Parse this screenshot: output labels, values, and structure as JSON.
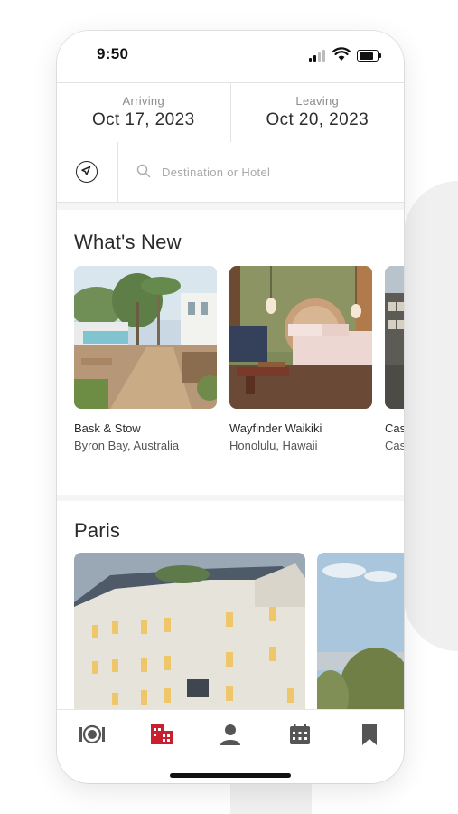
{
  "status": {
    "time": "9:50"
  },
  "dates": {
    "arriving_label": "Arriving",
    "arriving_value": "Oct 17, 2023",
    "leaving_label": "Leaving",
    "leaving_value": "Oct 20, 2023"
  },
  "search": {
    "placeholder": "Destination or Hotel"
  },
  "whats_new": {
    "title": "What's New",
    "cards": [
      {
        "name": "Bask & Stow",
        "location": "Byron Bay, Australia"
      },
      {
        "name": "Wayfinder Waikiki",
        "location": "Honolulu, Hawaii"
      },
      {
        "name": "Cas",
        "location": "Cas"
      }
    ]
  },
  "paris": {
    "title": "Paris"
  },
  "tabs": [
    {
      "icon": "dining-icon",
      "active": false
    },
    {
      "icon": "hotel-icon",
      "active": true
    },
    {
      "icon": "profile-icon",
      "active": false
    },
    {
      "icon": "calendar-icon",
      "active": false
    },
    {
      "icon": "bookmark-icon",
      "active": false
    }
  ],
  "colors": {
    "accent": "#c8202f",
    "icon_gray": "#555555",
    "divider": "#e3e3e3"
  }
}
